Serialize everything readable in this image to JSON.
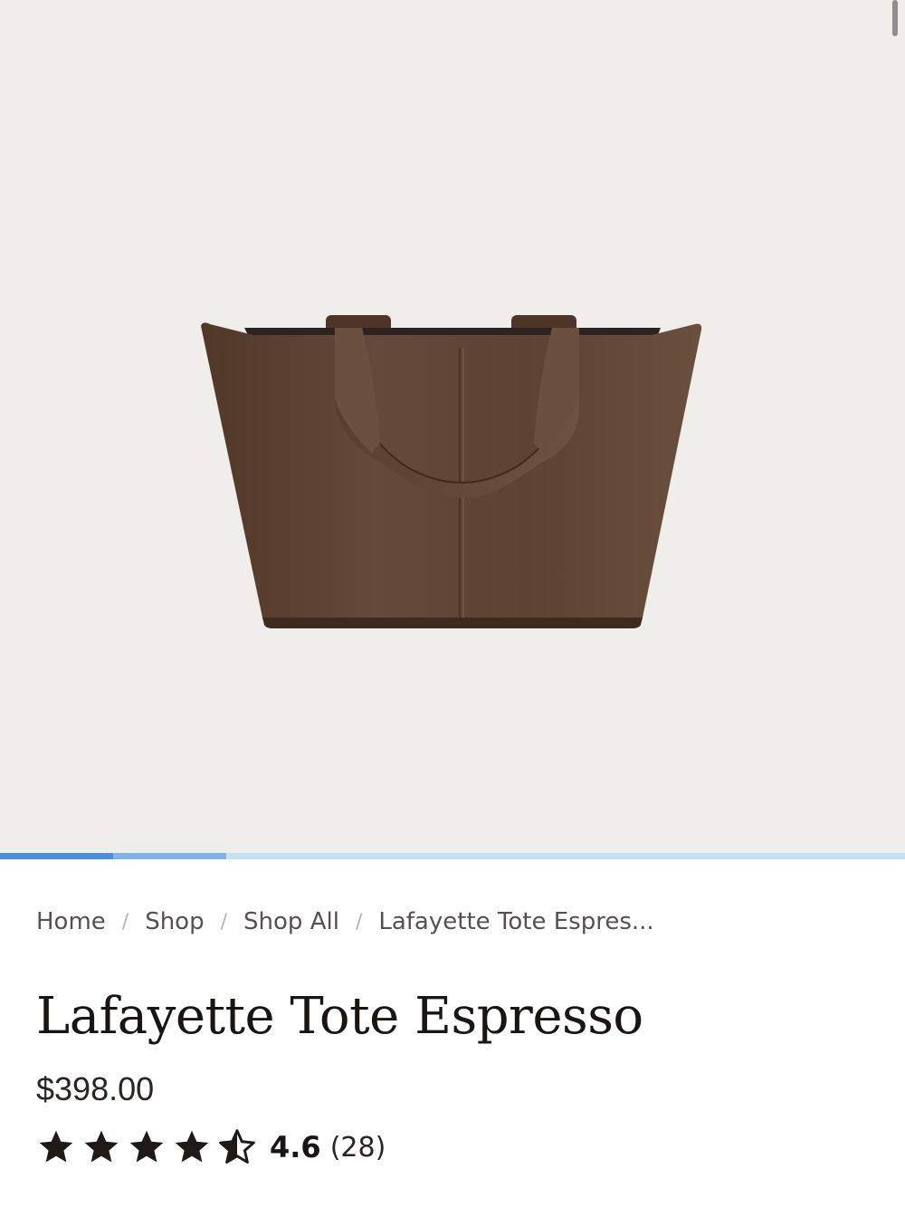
{
  "product": {
    "name": "Lafayette Tote Espresso",
    "price": "$398.00",
    "rating": "4.6",
    "review_count": "(28)",
    "rating_fraction": 0.92,
    "image_icon": "tote-bag-image",
    "color": "#5a3f31"
  },
  "breadcrumb": {
    "items": [
      "Home",
      "Shop",
      "Shop All",
      "Lafayette Tote Espres..."
    ],
    "separator": "/"
  },
  "gallery": {
    "slide_count": 8,
    "active_slide": 1,
    "progress_color": "#4a90d9",
    "background": "#f0eeeb"
  }
}
